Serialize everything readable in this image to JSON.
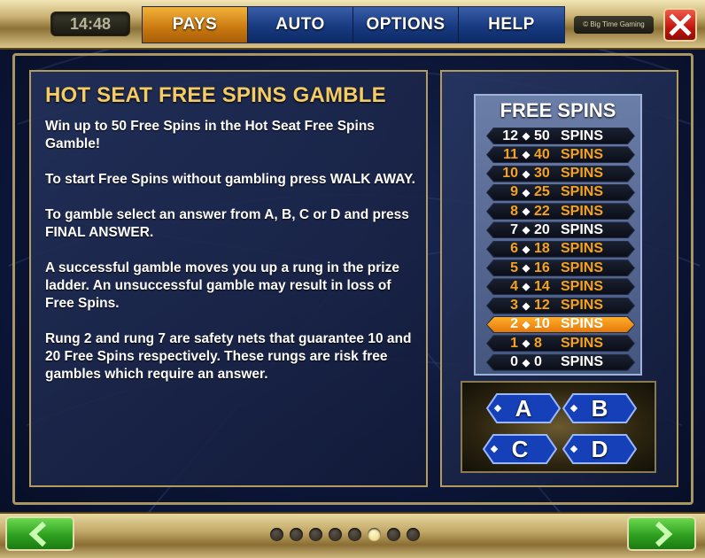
{
  "header": {
    "clock": "14:48",
    "tabs": [
      {
        "label": "PAYS",
        "active": true
      },
      {
        "label": "AUTO",
        "active": false
      },
      {
        "label": "OPTIONS",
        "active": false
      },
      {
        "label": "HELP",
        "active": false
      }
    ],
    "brand": "© Big Time Gaming"
  },
  "content": {
    "title": "HOT SEAT FREE SPINS GAMBLE",
    "paragraphs": [
      "Win up to 50 Free Spins in the Hot Seat Free Spins Gamble!",
      "To start Free Spins without gambling press WALK AWAY.",
      "To gamble select an answer from A, B, C or D and press FINAL ANSWER.",
      "A successful gamble moves you up a rung in the prize ladder. An unsuccessful gamble may result in loss of Free Spins.",
      "Rung 2 and rung 7 are safety nets that guarantee 10 and 20 Free Spins respectively. These rungs are risk free gambles which require an answer."
    ]
  },
  "ladder": {
    "title": "FREE SPINS",
    "unit": "SPINS",
    "rungs": [
      {
        "level": "12",
        "spins": "50",
        "style": "safe"
      },
      {
        "level": "11",
        "spins": "40",
        "style": "normal"
      },
      {
        "level": "10",
        "spins": "30",
        "style": "normal"
      },
      {
        "level": "9",
        "spins": "25",
        "style": "normal"
      },
      {
        "level": "8",
        "spins": "22",
        "style": "normal"
      },
      {
        "level": "7",
        "spins": "20",
        "style": "safe"
      },
      {
        "level": "6",
        "spins": "18",
        "style": "normal"
      },
      {
        "level": "5",
        "spins": "16",
        "style": "normal"
      },
      {
        "level": "4",
        "spins": "14",
        "style": "normal"
      },
      {
        "level": "3",
        "spins": "12",
        "style": "normal"
      },
      {
        "level": "2",
        "spins": "10",
        "style": "current"
      },
      {
        "level": "1",
        "spins": "8",
        "style": "normal"
      },
      {
        "level": "0",
        "spins": "0",
        "style": "safe"
      }
    ]
  },
  "answers": [
    "A",
    "B",
    "C",
    "D"
  ],
  "pagination": {
    "total": 8,
    "current": 6
  },
  "colors": {
    "accent_gold": "#f5cc63",
    "active_tab": "#c9780f",
    "current_rung": "#f08a12",
    "nav_green": "#2fa020",
    "close_red": "#c2160e"
  },
  "icons": {
    "close": "close-icon",
    "prev": "arrow-left-icon",
    "next": "arrow-right-icon",
    "rung_separator": "diamond-icon"
  }
}
